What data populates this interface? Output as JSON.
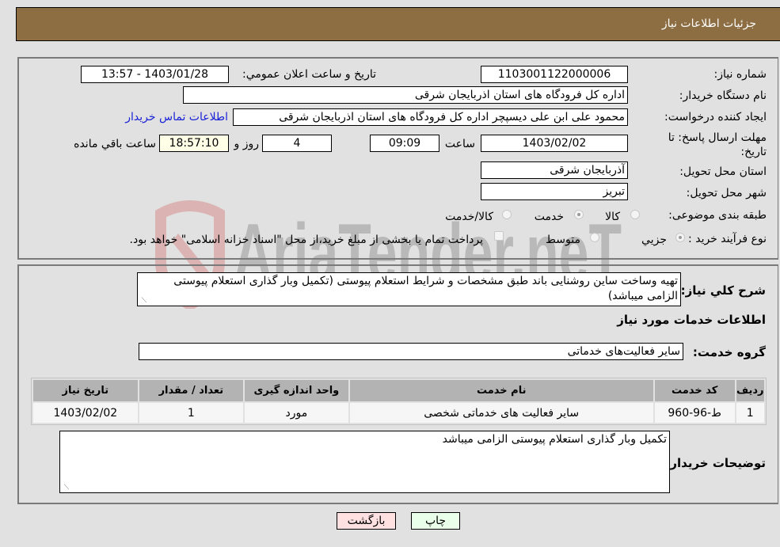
{
  "header": {
    "title": "جزئیات اطلاعات نیاز"
  },
  "form": {
    "need_number": {
      "label": "شماره نیاز:",
      "value": "1103001122000006"
    },
    "announce_datetime": {
      "label": "تاریخ و ساعت اعلان عمومي:",
      "value": "1403/01/28 - 13:57"
    },
    "buyer_org": {
      "label": "نام دستگاه خريدار:",
      "value": "اداره کل فرودگاه های استان اذربایجان شرقی"
    },
    "requester": {
      "label": "ایجاد کننده درخواست:",
      "value": "محمود علی ابن علی دیسپچر اداره کل فرودگاه های استان اذربایجان شرقی"
    },
    "contact_link": "اطلاعات تماس خریدار",
    "deadline": {
      "label": "مهلت ارسال پاسخ: تا تاریخ:",
      "date": "1403/02/02",
      "time_label": "ساعت",
      "time": "09:09",
      "days": "4",
      "days_label": "روز و",
      "remaining": "18:57:10",
      "remaining_label": "ساعت باقي مانده"
    },
    "delivery_province": {
      "label": "استان محل تحویل:",
      "value": "آذربایجان شرقی"
    },
    "delivery_city": {
      "label": "شهر محل تحویل:",
      "value": "تبریز"
    },
    "category": {
      "label": "طبقه بندی موضوعی:",
      "options": [
        {
          "label": "کالا",
          "selected": false
        },
        {
          "label": "خدمت",
          "selected": true
        },
        {
          "label": "کالا/خدمت",
          "selected": false
        }
      ]
    },
    "purchase_type": {
      "label": "نوع فرآیند خرید :",
      "options": [
        {
          "label": "جزيي",
          "selected": true
        },
        {
          "label": "متوسط",
          "selected": false
        }
      ],
      "treasury_checkbox_label": "پرداخت تمام یا بخشی از مبلغ خرید،از محل \"اسناد خزانه اسلامی\" خواهد بود.",
      "treasury_checked": false
    }
  },
  "details": {
    "summary_label": "شرح كلي نياز:",
    "summary_text": "تهیه وساخت ساین روشنایی باند طبق مشخصات و شرایط استعلام پیوستی (تکمیل وبار گذاری استعلام پیوستی الزامی میباشد)",
    "services_heading": "اطلاعات خدمات مورد نیاز",
    "service_group_label": "گروه خدمت:",
    "service_group_value": "سایر فعالیت‌های خدماتی",
    "table": {
      "headers": [
        "ردیف",
        "کد خدمت",
        "نام خدمت",
        "واحد اندازه گیری",
        "تعداد / مقدار",
        "تاریخ نیاز"
      ],
      "rows": [
        [
          "1",
          "ط-96-960",
          "سایر فعالیت های خدماتی شخصی",
          "مورد",
          "1",
          "1403/02/02"
        ]
      ]
    },
    "buyer_notes_label": "توضیحات خریدار:",
    "buyer_notes_text": "تکمیل وبار گذاری استعلام پیوستی الزامی میباشد"
  },
  "buttons": {
    "print": "چاپ",
    "back": "بازگشت"
  },
  "watermark": {
    "text": "AriaTender.neT"
  }
}
